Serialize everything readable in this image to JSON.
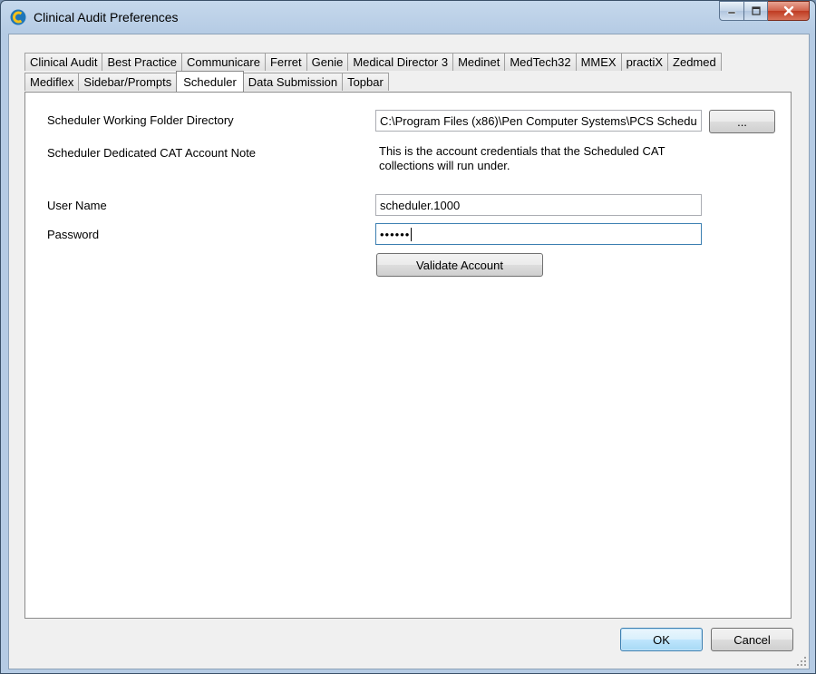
{
  "window": {
    "title": "Clinical Audit Preferences"
  },
  "tabs": {
    "row1": [
      "Clinical Audit",
      "Best Practice",
      "Communicare",
      "Ferret",
      "Genie",
      "Medical Director 3",
      "Medinet",
      "MedTech32",
      "MMEX",
      "practiX",
      "Zedmed"
    ],
    "row2": [
      "Mediflex",
      "Sidebar/Prompts",
      "Scheduler",
      "Data Submission",
      "Topbar"
    ],
    "active": "Scheduler"
  },
  "scheduler": {
    "working_folder_label": "Scheduler Working Folder Directory",
    "working_folder_value": "C:\\Program Files (x86)\\Pen Computer Systems\\PCS Schedu",
    "browse_label": "...",
    "account_note_label": "Scheduler Dedicated CAT Account Note",
    "account_note_text": "This is the account credentials that the Scheduled CAT collections will run under.",
    "username_label": "User Name",
    "username_value": "scheduler.1000",
    "password_label": "Password",
    "password_value": "••••••",
    "validate_label": "Validate Account"
  },
  "footer": {
    "ok_label": "OK",
    "cancel_label": "Cancel"
  },
  "colors": {
    "accent": "#3c7fb1",
    "close_button": "#c9472e"
  }
}
